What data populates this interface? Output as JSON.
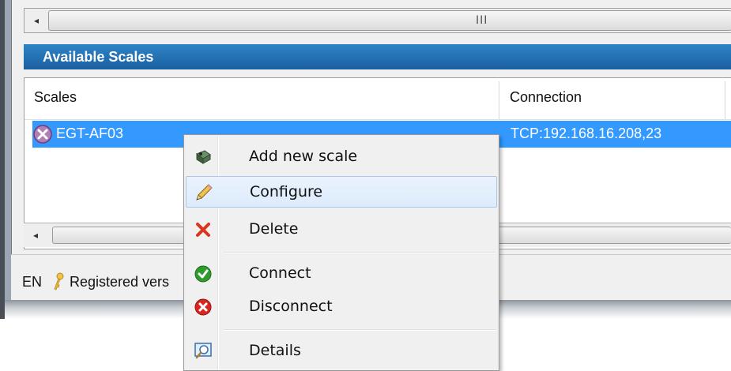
{
  "top_fragment": "",
  "scrollbar": {
    "left_arrow": "◂",
    "grip": "III"
  },
  "panel": {
    "title": "Available Scales"
  },
  "table": {
    "columns": [
      "Scales",
      "Connection"
    ],
    "rows": [
      {
        "name": "EGT-AF03",
        "connection": "TCP:192.168.16.208,23",
        "status_icon": "disconnected-x-icon"
      }
    ]
  },
  "status_bar": {
    "language": "EN",
    "key_icon": "key-icon",
    "registration_text": "Registered vers"
  },
  "context_menu": {
    "items": [
      {
        "label": "Add new scale",
        "icon": "add-scale-icon"
      },
      {
        "label": "Configure",
        "icon": "pencil-icon"
      },
      {
        "label": "Delete",
        "icon": "delete-x-icon"
      },
      {
        "label": "Connect",
        "icon": "connect-check-icon"
      },
      {
        "label": "Disconnect",
        "icon": "disconnect-x-icon"
      },
      {
        "label": "Details",
        "icon": "details-magnifier-icon"
      }
    ],
    "highlighted": "Configure"
  },
  "colors": {
    "selection": "#3399ff",
    "header_blue": "#1f6fb3",
    "menu_highlight": "#dcebfc"
  }
}
